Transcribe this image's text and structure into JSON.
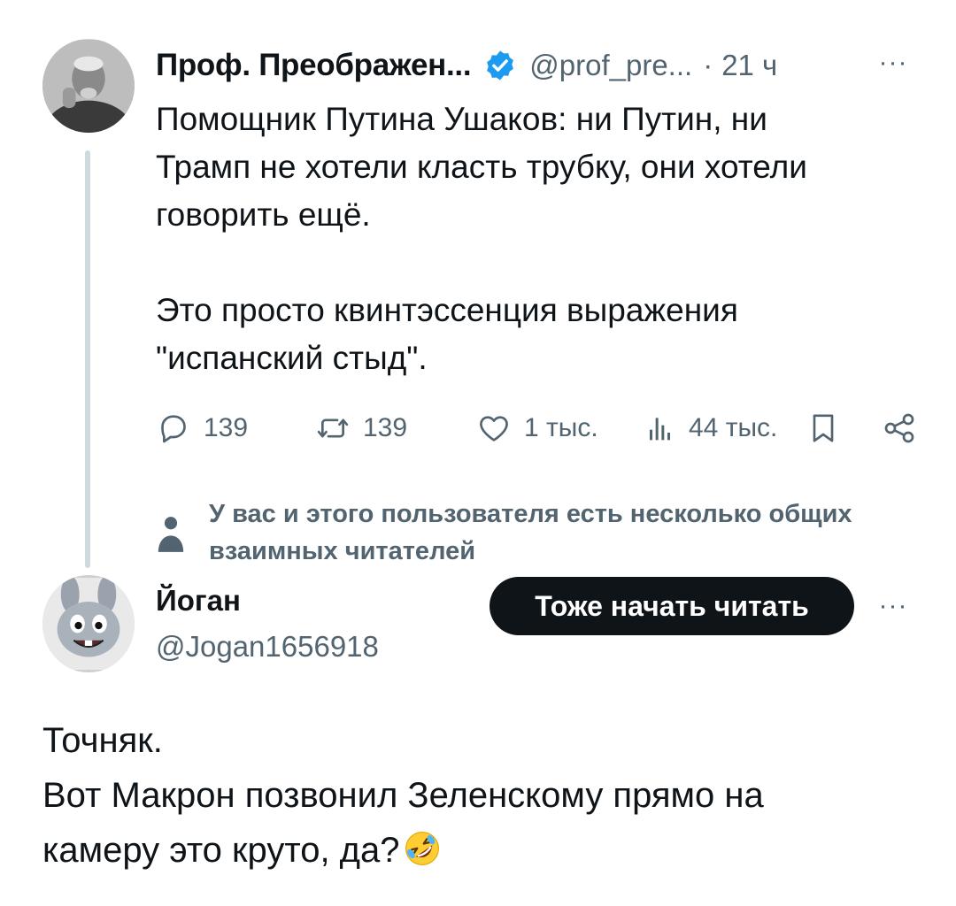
{
  "tweet": {
    "author": {
      "display_name": "Проф. Преображен...",
      "handle": "@prof_pre...",
      "verified": true,
      "avatar_icon": "portrait-avatar"
    },
    "separator": "·",
    "time": "21 ч",
    "more_label": "···",
    "text": {
      "paragraph1_line1": "Помощник Путина Ушаков: ни Путин, ни",
      "paragraph1_line2": "Трамп не хотели класть трубку, они хотели",
      "paragraph1_line3": "говорить ещё.",
      "paragraph2_line1": "Это просто квинтэссенция выражения",
      "paragraph2_line2": "\"испанский стыд\"."
    },
    "actions": {
      "replies": "139",
      "reposts": "139",
      "likes": "1 тыс.",
      "views": "44 тыс."
    },
    "social_context": {
      "line1": "У вас и этого пользователя есть несколько общих",
      "line2": "взаимных читателей"
    }
  },
  "reply": {
    "author": {
      "display_name": "Йоган",
      "handle": "@Jogan1656918",
      "avatar_icon": "cartoon-rabbit-avatar"
    },
    "follow_label": "Тоже начать читать",
    "more_label": "···",
    "text": {
      "line1": "Точняк.",
      "line2": "Вот Макрон позвонил Зеленскому прямо на",
      "line3": "камеру это круто, да?"
    },
    "emoji": "rolling-on-floor-laughing"
  },
  "colors": {
    "text_primary": "#0f1419",
    "text_secondary": "#536471",
    "verified_blue": "#1d9bf0",
    "thread_line": "#cfd9de",
    "follow_button_bg": "#0f1419"
  }
}
